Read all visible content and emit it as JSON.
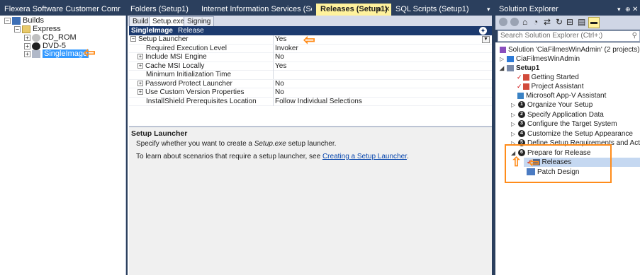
{
  "tabs": [
    {
      "label": "Flexera Software Customer Comr",
      "active": false
    },
    {
      "label": "Folders (Setup1)",
      "active": false
    },
    {
      "label": "Internet Information Services (Set",
      "active": false
    },
    {
      "label": "Releases (Setup1)",
      "active": true
    },
    {
      "label": "SQL Scripts (Setup1)",
      "active": false
    }
  ],
  "builds_tree": {
    "root": "Builds",
    "express": "Express",
    "items": [
      "CD_ROM",
      "DVD-5",
      "SingleImage"
    ]
  },
  "subtabs": [
    "Build",
    "Setup.exe",
    "Signing"
  ],
  "grid_header": {
    "name": "SingleImage",
    "type": "Release"
  },
  "grid_rows": [
    {
      "name": "Setup Launcher",
      "value": "Yes",
      "expander": "minus"
    },
    {
      "name": "Required Execution Level",
      "value": "Invoker",
      "expander": ""
    },
    {
      "name": "Include MSI Engine",
      "value": "No",
      "expander": "plus"
    },
    {
      "name": "Cache MSI Locally",
      "value": "Yes",
      "expander": "plus"
    },
    {
      "name": "Minimum Initialization Time",
      "value": "",
      "expander": ""
    },
    {
      "name": "Password Protect Launcher",
      "value": "No",
      "expander": "plus"
    },
    {
      "name": "Use Custom Version Properties",
      "value": "No",
      "expander": "plus"
    },
    {
      "name": "InstallShield Prerequisites Location",
      "value": "Follow Individual Selections",
      "expander": ""
    }
  ],
  "description": {
    "title": "Setup Launcher",
    "line1_pre": "Specify whether you want to create a",
    "line1_italic": "Setup.exe",
    "line1_post": "setup launcher.",
    "line2_pre": "To learn about scenarios that require a setup launcher, see",
    "line2_link": "Creating a Setup Launcher",
    "line2_post": "."
  },
  "solution_explorer": {
    "title": "Solution Explorer",
    "search_placeholder": "Search Solution Explorer (Ctrl+;)",
    "solution": "Solution 'CiaFilmesWinAdmin' (2 projects)",
    "project1": "CiaFilmesWinAdmin",
    "project2": "Setup1",
    "items": [
      {
        "label": "Getting Started",
        "num": ""
      },
      {
        "label": "Project Assistant",
        "num": ""
      },
      {
        "label": "Microsoft App-V Assistant",
        "num": ""
      },
      {
        "label": "Organize Your Setup",
        "num": "1"
      },
      {
        "label": "Specify Application Data",
        "num": "2"
      },
      {
        "label": "Configure the Target System",
        "num": "3"
      },
      {
        "label": "Customize the Setup Appearance",
        "num": "4"
      },
      {
        "label": "Define Setup Requirements and Actions",
        "num": "5"
      },
      {
        "label": "Prepare for Release",
        "num": "6"
      }
    ],
    "sub_items": [
      "Releases",
      "Patch Design"
    ]
  },
  "colors": {
    "accent": "#ff8c1a",
    "title_bar": "#2b3f5d",
    "active_tab": "#fff29d",
    "selection": "#3399ff"
  }
}
